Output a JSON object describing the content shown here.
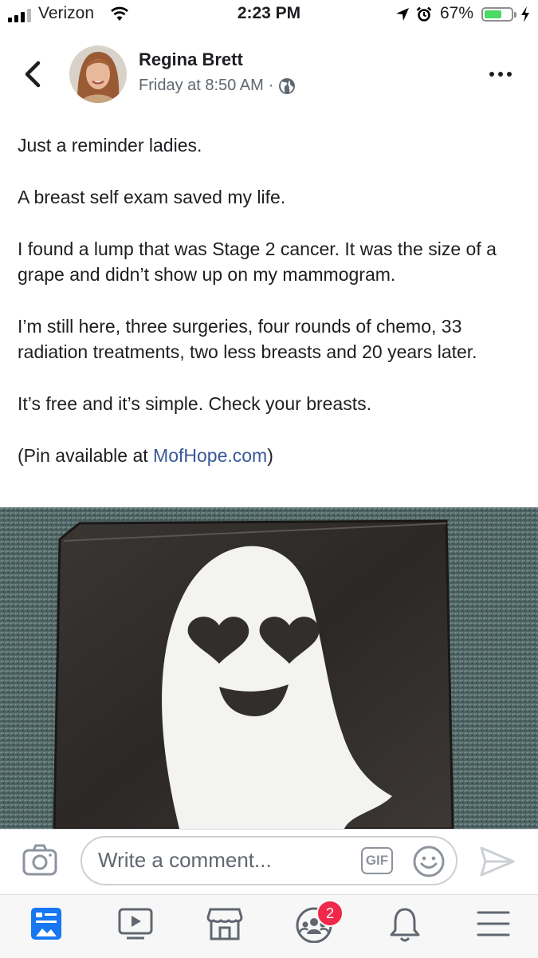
{
  "status_bar": {
    "carrier": "Verizon",
    "time": "2:23 PM",
    "battery": "67%",
    "battery_level": 0.67,
    "icons": [
      "signal-icon",
      "wifi-icon",
      "location-icon",
      "alarm-icon",
      "battery-icon",
      "charging-bolt-icon"
    ]
  },
  "post": {
    "author": "Regina Brett",
    "timestamp": "Friday at 8:50 AM",
    "separator": "·",
    "privacy_icon": "globe-icon",
    "paragraphs": [
      "Just a reminder ladies.",
      "A breast self exam saved my life.",
      "I found a lump that was Stage 2 cancer. It was the size of a grape and didn’t show up on my mammogram.",
      "I’m still here, three surgeries, four rounds of chemo, 33 radiation treatments, two less breasts and 20 years later.",
      "It’s free and it’s simple. Check your breasts."
    ],
    "last_line_prefix": "(Pin available at ",
    "link_text": "MofHope.com",
    "last_line_suffix": ")"
  },
  "comment_bar": {
    "placeholder": "Write a comment...",
    "gif_label": "GIF",
    "icons": [
      "camera-icon",
      "gif-icon",
      "emoji-icon",
      "send-icon"
    ]
  },
  "tab_bar": {
    "tabs": [
      "news-feed-icon",
      "watch-icon",
      "marketplace-icon",
      "groups-icon",
      "notifications-icon",
      "menu-icon"
    ],
    "groups_badge": "2"
  },
  "colors": {
    "link": "#385898",
    "active_tab": "#1877f2",
    "badge": "#f02849",
    "battery": "#4cd964"
  }
}
